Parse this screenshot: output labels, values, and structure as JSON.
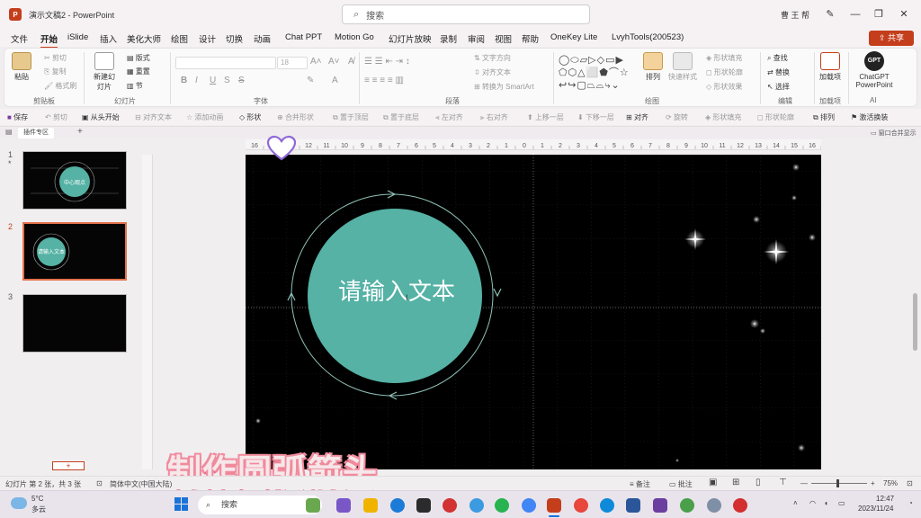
{
  "window": {
    "doc_title": "演示文稿2",
    "separator": "-",
    "app": "PowerPoint",
    "search_placeholder": "搜索",
    "user": "曹 王 帮"
  },
  "menu": {
    "tabs": [
      "文件",
      "开始",
      "iSlide",
      "插入",
      "美化大师",
      "绘图",
      "设计",
      "切换",
      "动画",
      "Chat PPT",
      "Motion Go",
      "幻灯片放映",
      "录制",
      "审阅",
      "视图",
      "帮助",
      "OneKey Lite",
      "LvyhTools(200523)"
    ],
    "active": "开始",
    "share": "共享"
  },
  "ribbon": {
    "clipboard": {
      "paste": "粘贴",
      "cut": "剪切",
      "copy": "复制",
      "format_painter": "格式刷",
      "group": "剪贴板"
    },
    "slides": {
      "new_slide": "新建幻灯片",
      "layout": "版式",
      "reset": "重置",
      "section": "节",
      "group": "幻灯片"
    },
    "font": {
      "size_placeholder": "18",
      "bold": "B",
      "italic": "I",
      "underline": "U",
      "strike": "S",
      "group": "字体"
    },
    "paragraph": {
      "text_direction": "文字方向",
      "align_text": "对齐文本",
      "smartart": "转换为 SmartArt",
      "group": "段落"
    },
    "drawing": {
      "arrange": "排列",
      "quick_styles": "快速样式",
      "fill": "形状填充",
      "outline": "形状轮廓",
      "effects": "形状效果",
      "group": "绘图"
    },
    "editing": {
      "find": "查找",
      "replace": "替换",
      "select": "选择",
      "group": "编辑"
    },
    "addins": {
      "label": "加载项",
      "group": "加载项"
    },
    "ai": {
      "badge": "GPT",
      "label": "ChatGPT PowerPoint",
      "group": "AI"
    }
  },
  "quickbar": [
    "保存",
    "剪切",
    "从头开始",
    "对齐文本",
    "添加动画",
    "形状",
    "合并形状",
    "置于顶层",
    "置于底层",
    "左对齐",
    "右对齐",
    "上移一层",
    "下移一层",
    "对齐",
    "旋转",
    "形状填充",
    "形状轮廓",
    "排列",
    "激活换装"
  ],
  "doc_tab": {
    "label": "插件专区",
    "merge_windows": "窗口合并显示"
  },
  "thumbnails": [
    {
      "num": "1",
      "title": "中心观点",
      "selected": false
    },
    {
      "num": "2",
      "title": "请输入文本",
      "selected": true
    },
    {
      "num": "3",
      "title": "",
      "selected": false
    }
  ],
  "ruler_labels": [
    "16",
    "14",
    "13",
    "12",
    "11",
    "10",
    "9",
    "8",
    "7",
    "6",
    "5",
    "4",
    "3",
    "2",
    "1",
    "0",
    "1",
    "2",
    "3",
    "4",
    "5",
    "6",
    "7",
    "8",
    "9",
    "10",
    "11",
    "12",
    "13",
    "14",
    "15",
    "16"
  ],
  "slide": {
    "main_text": "请输入文本",
    "circle_color": "#55b2a5",
    "arc_color": "#8fc2b8"
  },
  "overlay": {
    "caption": "制作圆弧箭头"
  },
  "status": {
    "slide_count": "幻灯片 第 2 张，共 3 张",
    "language": "简体中文(中国大陆)",
    "notes": "备注",
    "comments": "批注",
    "zoom": "75%"
  },
  "taskbar": {
    "weather_temp": "5°C",
    "weather_desc": "多云",
    "search": "搜索",
    "time": "12:47",
    "date": "2023/11/24"
  },
  "colors": {
    "accent": "#c43e1c",
    "selection": "#e2714b"
  }
}
